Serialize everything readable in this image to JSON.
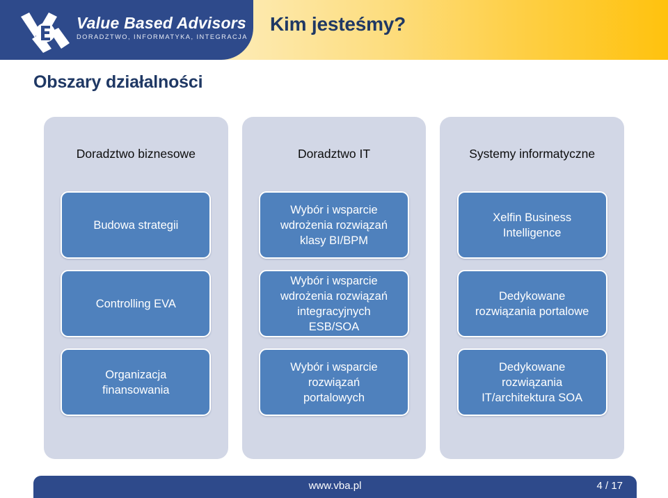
{
  "header": {
    "logo": {
      "icon_name": "vba-monogram-logo",
      "title": "Value Based Advisors",
      "subtitle": "DORADZTWO, INFORMATYKA, INTEGRACJA",
      "block_color": "#2e4a8b"
    },
    "title": "Kim jesteśmy?",
    "gradient_from": "#fdf4dd",
    "gradient_to": "#ffc20e",
    "title_color": "#1f3864"
  },
  "slide": {
    "title": "Obszary działalności",
    "title_color": "#1f3864"
  },
  "columns": [
    {
      "header": "Doradztwo biznesowe",
      "panel_color": "#d2d7e6",
      "cards": [
        "Budowa strategii",
        "Controlling EVA",
        "Organizacja\nfinansowania"
      ]
    },
    {
      "header": "Doradztwo IT",
      "panel_color": "#d2d7e6",
      "cards": [
        "Wybór i wsparcie\nwdrożenia rozwiązań\nklasy BI/BPM",
        "Wybór i wsparcie\nwdrożenia rozwiązań\nintegracyjnych\nESB/SOA",
        "Wybór i wsparcie\nrozwiązań\nportalowych"
      ]
    },
    {
      "header": "Systemy informatyczne",
      "panel_color": "#d2d7e6",
      "cards": [
        "Xelfin Business\nIntelligence",
        "Dedykowane\nrozwiązania portalowe",
        "Dedykowane\nrozwiązania\nIT/architektura SOA"
      ]
    }
  ],
  "card_color": "#4f81bd",
  "footer": {
    "website": "www.vba.pl",
    "page": "4 / 17",
    "bar_color": "#2e4a8b"
  }
}
